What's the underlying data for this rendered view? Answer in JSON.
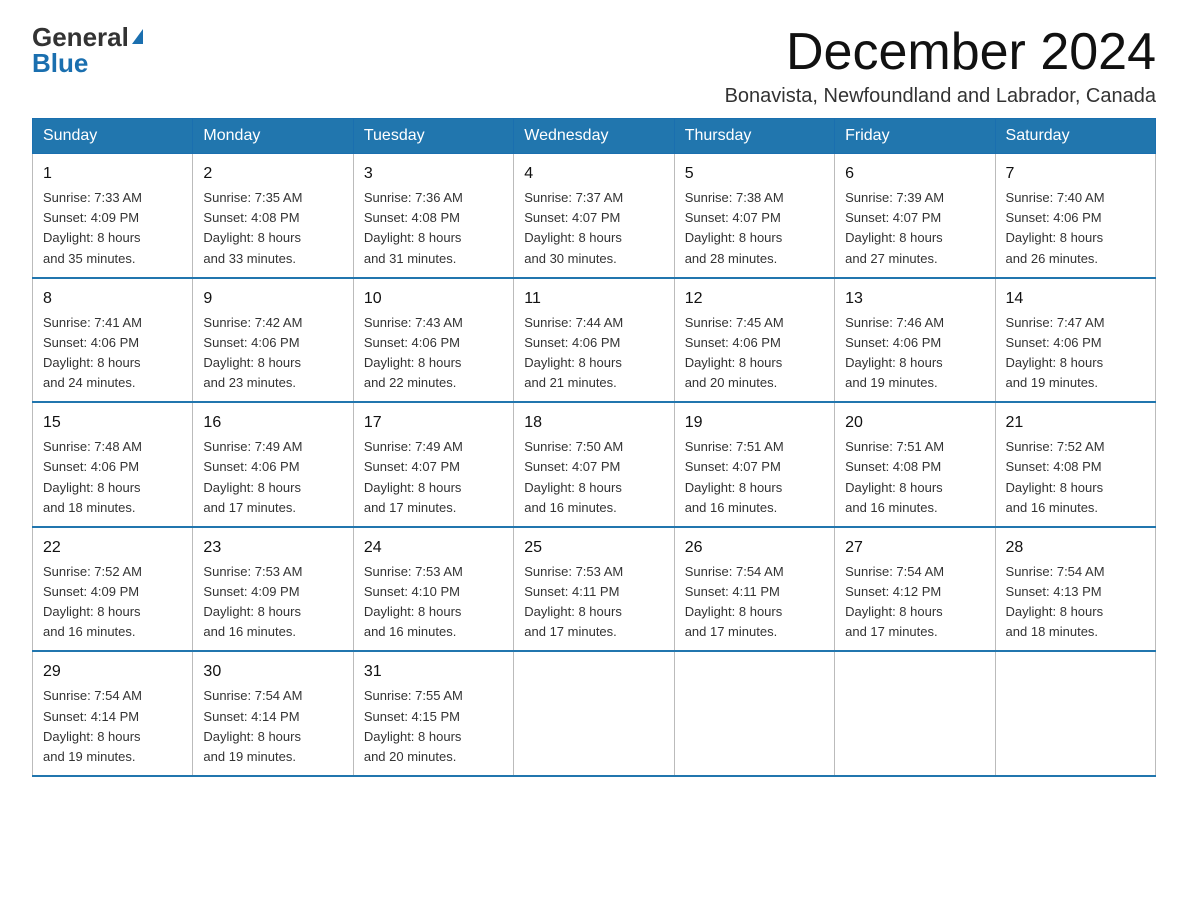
{
  "header": {
    "logo_general": "General",
    "logo_blue": "Blue",
    "month_title": "December 2024",
    "location": "Bonavista, Newfoundland and Labrador, Canada"
  },
  "days_of_week": [
    "Sunday",
    "Monday",
    "Tuesday",
    "Wednesday",
    "Thursday",
    "Friday",
    "Saturday"
  ],
  "weeks": [
    [
      {
        "day": "1",
        "sunrise": "7:33 AM",
        "sunset": "4:09 PM",
        "daylight": "8 hours and 35 minutes."
      },
      {
        "day": "2",
        "sunrise": "7:35 AM",
        "sunset": "4:08 PM",
        "daylight": "8 hours and 33 minutes."
      },
      {
        "day": "3",
        "sunrise": "7:36 AM",
        "sunset": "4:08 PM",
        "daylight": "8 hours and 31 minutes."
      },
      {
        "day": "4",
        "sunrise": "7:37 AM",
        "sunset": "4:07 PM",
        "daylight": "8 hours and 30 minutes."
      },
      {
        "day": "5",
        "sunrise": "7:38 AM",
        "sunset": "4:07 PM",
        "daylight": "8 hours and 28 minutes."
      },
      {
        "day": "6",
        "sunrise": "7:39 AM",
        "sunset": "4:07 PM",
        "daylight": "8 hours and 27 minutes."
      },
      {
        "day": "7",
        "sunrise": "7:40 AM",
        "sunset": "4:06 PM",
        "daylight": "8 hours and 26 minutes."
      }
    ],
    [
      {
        "day": "8",
        "sunrise": "7:41 AM",
        "sunset": "4:06 PM",
        "daylight": "8 hours and 24 minutes."
      },
      {
        "day": "9",
        "sunrise": "7:42 AM",
        "sunset": "4:06 PM",
        "daylight": "8 hours and 23 minutes."
      },
      {
        "day": "10",
        "sunrise": "7:43 AM",
        "sunset": "4:06 PM",
        "daylight": "8 hours and 22 minutes."
      },
      {
        "day": "11",
        "sunrise": "7:44 AM",
        "sunset": "4:06 PM",
        "daylight": "8 hours and 21 minutes."
      },
      {
        "day": "12",
        "sunrise": "7:45 AM",
        "sunset": "4:06 PM",
        "daylight": "8 hours and 20 minutes."
      },
      {
        "day": "13",
        "sunrise": "7:46 AM",
        "sunset": "4:06 PM",
        "daylight": "8 hours and 19 minutes."
      },
      {
        "day": "14",
        "sunrise": "7:47 AM",
        "sunset": "4:06 PM",
        "daylight": "8 hours and 19 minutes."
      }
    ],
    [
      {
        "day": "15",
        "sunrise": "7:48 AM",
        "sunset": "4:06 PM",
        "daylight": "8 hours and 18 minutes."
      },
      {
        "day": "16",
        "sunrise": "7:49 AM",
        "sunset": "4:06 PM",
        "daylight": "8 hours and 17 minutes."
      },
      {
        "day": "17",
        "sunrise": "7:49 AM",
        "sunset": "4:07 PM",
        "daylight": "8 hours and 17 minutes."
      },
      {
        "day": "18",
        "sunrise": "7:50 AM",
        "sunset": "4:07 PM",
        "daylight": "8 hours and 16 minutes."
      },
      {
        "day": "19",
        "sunrise": "7:51 AM",
        "sunset": "4:07 PM",
        "daylight": "8 hours and 16 minutes."
      },
      {
        "day": "20",
        "sunrise": "7:51 AM",
        "sunset": "4:08 PM",
        "daylight": "8 hours and 16 minutes."
      },
      {
        "day": "21",
        "sunrise": "7:52 AM",
        "sunset": "4:08 PM",
        "daylight": "8 hours and 16 minutes."
      }
    ],
    [
      {
        "day": "22",
        "sunrise": "7:52 AM",
        "sunset": "4:09 PM",
        "daylight": "8 hours and 16 minutes."
      },
      {
        "day": "23",
        "sunrise": "7:53 AM",
        "sunset": "4:09 PM",
        "daylight": "8 hours and 16 minutes."
      },
      {
        "day": "24",
        "sunrise": "7:53 AM",
        "sunset": "4:10 PM",
        "daylight": "8 hours and 16 minutes."
      },
      {
        "day": "25",
        "sunrise": "7:53 AM",
        "sunset": "4:11 PM",
        "daylight": "8 hours and 17 minutes."
      },
      {
        "day": "26",
        "sunrise": "7:54 AM",
        "sunset": "4:11 PM",
        "daylight": "8 hours and 17 minutes."
      },
      {
        "day": "27",
        "sunrise": "7:54 AM",
        "sunset": "4:12 PM",
        "daylight": "8 hours and 17 minutes."
      },
      {
        "day": "28",
        "sunrise": "7:54 AM",
        "sunset": "4:13 PM",
        "daylight": "8 hours and 18 minutes."
      }
    ],
    [
      {
        "day": "29",
        "sunrise": "7:54 AM",
        "sunset": "4:14 PM",
        "daylight": "8 hours and 19 minutes."
      },
      {
        "day": "30",
        "sunrise": "7:54 AM",
        "sunset": "4:14 PM",
        "daylight": "8 hours and 19 minutes."
      },
      {
        "day": "31",
        "sunrise": "7:55 AM",
        "sunset": "4:15 PM",
        "daylight": "8 hours and 20 minutes."
      },
      null,
      null,
      null,
      null
    ]
  ]
}
